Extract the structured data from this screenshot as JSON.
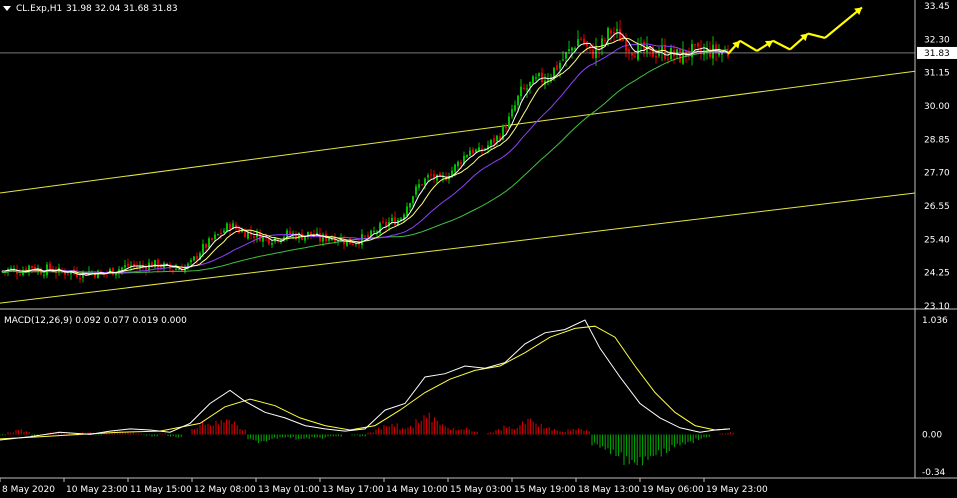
{
  "header": {
    "symbol_label": "CL.Exp,H1",
    "ohlc_text": "31.98 32.04 31.68 31.83"
  },
  "colors": {
    "background": "#000000",
    "bull_candle": "#00c000",
    "bear_candle": "#e00000",
    "ma_fast": "#ffffff",
    "ma_mid": "#ffff80",
    "ma_slow_purple": "#9040ff",
    "ma_slow_green": "#40c040",
    "channel": "#e6e640",
    "forecast_arrow": "#ffff00",
    "macd_line": "#ffffff",
    "signal_line": "#ffff40",
    "hist_positive": "#e00000",
    "hist_negative": "#00b000",
    "price_badge_bg": "#ffffff",
    "grid_line": "#c0c0c0"
  },
  "chart_data": [
    {
      "type": "candlestick",
      "title": "",
      "price_axis_ticks": [
        "33.45",
        "32.30",
        "31.15",
        "30.00",
        "28.85",
        "27.70",
        "26.55",
        "25.40",
        "24.25",
        "23.10"
      ],
      "ylim": [
        23.1,
        33.45
      ],
      "current_price": "31.83",
      "x_tick_labels": [
        "8 May 2020",
        "10 May 23:00",
        "11 May 15:00",
        "12 May 08:00",
        "13 May 01:00",
        "13 May 17:00",
        "14 May 10:00",
        "15 May 03:00",
        "15 May 19:00",
        "18 May 13:00",
        "19 May 06:00",
        "19 May 23:00"
      ],
      "close_path": [
        [
          0,
          24.3
        ],
        [
          10,
          24.35
        ],
        [
          20,
          24.3
        ],
        [
          30,
          24.5
        ],
        [
          40,
          24.3
        ],
        [
          50,
          24.4
        ],
        [
          60,
          24.25
        ],
        [
          70,
          24.3
        ],
        [
          80,
          24.2
        ],
        [
          90,
          24.3
        ],
        [
          100,
          24.2
        ],
        [
          110,
          24.3
        ],
        [
          120,
          24.4
        ],
        [
          130,
          24.5
        ],
        [
          140,
          24.45
        ],
        [
          150,
          24.55
        ],
        [
          160,
          24.5
        ],
        [
          170,
          24.4
        ],
        [
          180,
          24.4
        ],
        [
          190,
          24.5
        ],
        [
          200,
          25.0
        ],
        [
          210,
          25.3
        ],
        [
          220,
          25.6
        ],
        [
          230,
          25.9
        ],
        [
          240,
          25.7
        ],
        [
          250,
          25.6
        ],
        [
          260,
          25.5
        ],
        [
          270,
          25.4
        ],
        [
          280,
          25.5
        ],
        [
          290,
          25.6
        ],
        [
          300,
          25.5
        ],
        [
          310,
          25.6
        ],
        [
          320,
          25.4
        ],
        [
          330,
          25.5
        ],
        [
          340,
          25.4
        ],
        [
          350,
          25.3
        ],
        [
          360,
          25.4
        ],
        [
          370,
          25.5
        ],
        [
          380,
          25.8
        ],
        [
          390,
          26.0
        ],
        [
          400,
          26.1
        ],
        [
          410,
          26.8
        ],
        [
          420,
          27.3
        ],
        [
          430,
          27.6
        ],
        [
          440,
          27.4
        ],
        [
          450,
          27.7
        ],
        [
          460,
          28.1
        ],
        [
          470,
          28.5
        ],
        [
          480,
          28.4
        ],
        [
          490,
          28.7
        ],
        [
          500,
          29.0
        ],
        [
          510,
          29.6
        ],
        [
          520,
          30.4
        ],
        [
          530,
          30.7
        ],
        [
          540,
          30.9
        ],
        [
          550,
          31.1
        ],
        [
          560,
          31.5
        ],
        [
          570,
          31.9
        ],
        [
          580,
          32.4
        ],
        [
          590,
          31.8
        ],
        [
          600,
          32.0
        ],
        [
          610,
          32.6
        ],
        [
          620,
          32.4
        ],
        [
          630,
          32.0
        ],
        [
          640,
          31.9
        ],
        [
          650,
          31.8
        ],
        [
          660,
          31.9
        ],
        [
          670,
          31.8
        ],
        [
          680,
          31.7
        ],
        [
          690,
          31.9
        ],
        [
          700,
          31.8
        ],
        [
          710,
          31.9
        ],
        [
          720,
          31.85
        ],
        [
          730,
          31.83
        ]
      ],
      "channel_lines": [
        {
          "from": [
            0,
            27.0
          ],
          "to": [
            915,
            31.2
          ]
        },
        {
          "from": [
            0,
            23.2
          ],
          "to": [
            915,
            27.0
          ]
        }
      ],
      "forecast_path": [
        [
          728,
          31.8
        ],
        [
          740,
          32.25
        ],
        [
          757,
          31.9
        ],
        [
          773,
          32.25
        ],
        [
          790,
          31.95
        ],
        [
          808,
          32.5
        ],
        [
          825,
          32.35
        ],
        [
          862,
          33.4
        ]
      ]
    },
    {
      "type": "macd",
      "title": "MACD(12,26,9) 0.092 0.077 0.019 0.000",
      "axis_ticks": [
        "1.036",
        "0.00",
        "-0.34"
      ],
      "ylim": [
        -0.34,
        1.036
      ],
      "macd_path": [
        [
          0,
          -0.05
        ],
        [
          30,
          -0.02
        ],
        [
          60,
          0.02
        ],
        [
          90,
          0.0
        ],
        [
          110,
          0.03
        ],
        [
          130,
          0.05
        ],
        [
          150,
          0.04
        ],
        [
          170,
          0.02
        ],
        [
          190,
          0.1
        ],
        [
          210,
          0.28
        ],
        [
          230,
          0.4
        ],
        [
          245,
          0.3
        ],
        [
          265,
          0.2
        ],
        [
          285,
          0.15
        ],
        [
          305,
          0.08
        ],
        [
          325,
          0.05
        ],
        [
          345,
          0.03
        ],
        [
          365,
          0.05
        ],
        [
          385,
          0.22
        ],
        [
          405,
          0.28
        ],
        [
          425,
          0.52
        ],
        [
          445,
          0.55
        ],
        [
          465,
          0.62
        ],
        [
          485,
          0.6
        ],
        [
          505,
          0.65
        ],
        [
          525,
          0.82
        ],
        [
          545,
          0.92
        ],
        [
          565,
          0.95
        ],
        [
          585,
          1.036
        ],
        [
          600,
          0.78
        ],
        [
          620,
          0.52
        ],
        [
          640,
          0.28
        ],
        [
          660,
          0.15
        ],
        [
          680,
          0.06
        ],
        [
          700,
          0.02
        ],
        [
          715,
          0.04
        ],
        [
          730,
          0.05
        ]
      ],
      "signal_path": [
        [
          0,
          -0.04
        ],
        [
          40,
          -0.02
        ],
        [
          80,
          0.0
        ],
        [
          120,
          0.02
        ],
        [
          160,
          0.03
        ],
        [
          200,
          0.1
        ],
        [
          225,
          0.25
        ],
        [
          250,
          0.32
        ],
        [
          275,
          0.26
        ],
        [
          300,
          0.15
        ],
        [
          325,
          0.08
        ],
        [
          350,
          0.04
        ],
        [
          375,
          0.08
        ],
        [
          400,
          0.22
        ],
        [
          425,
          0.38
        ],
        [
          450,
          0.5
        ],
        [
          475,
          0.58
        ],
        [
          500,
          0.62
        ],
        [
          525,
          0.74
        ],
        [
          550,
          0.88
        ],
        [
          575,
          0.96
        ],
        [
          595,
          0.98
        ],
        [
          615,
          0.88
        ],
        [
          635,
          0.62
        ],
        [
          655,
          0.38
        ],
        [
          675,
          0.2
        ],
        [
          695,
          0.08
        ],
        [
          715,
          0.04
        ],
        [
          730,
          0.05
        ]
      ],
      "histogram": [
        [
          0,
          -0.01
        ],
        [
          8,
          0.02
        ],
        [
          16,
          0.05
        ],
        [
          24,
          0.03
        ],
        [
          32,
          -0.02
        ],
        [
          40,
          0.0
        ],
        [
          48,
          0.02
        ],
        [
          56,
          0.03
        ],
        [
          64,
          0.01
        ],
        [
          72,
          -0.01
        ],
        [
          80,
          0.02
        ],
        [
          88,
          0.02
        ],
        [
          96,
          -0.01
        ],
        [
          104,
          0.02
        ],
        [
          112,
          0.04
        ],
        [
          120,
          0.03
        ],
        [
          128,
          0.02
        ],
        [
          136,
          0.01
        ],
        [
          144,
          -0.01
        ],
        [
          152,
          -0.02
        ],
        [
          160,
          0.01
        ],
        [
          168,
          -0.02
        ],
        [
          176,
          -0.03
        ],
        [
          184,
          0.0
        ],
        [
          192,
          0.06
        ],
        [
          200,
          0.12
        ],
        [
          208,
          0.1
        ],
        [
          216,
          0.13
        ],
        [
          224,
          0.15
        ],
        [
          232,
          0.12
        ],
        [
          240,
          0.05
        ],
        [
          248,
          -0.05
        ],
        [
          256,
          -0.08
        ],
        [
          264,
          -0.07
        ],
        [
          272,
          -0.04
        ],
        [
          280,
          -0.03
        ],
        [
          288,
          -0.03
        ],
        [
          296,
          -0.05
        ],
        [
          304,
          -0.04
        ],
        [
          312,
          -0.03
        ],
        [
          320,
          -0.04
        ],
        [
          328,
          -0.02
        ],
        [
          336,
          -0.02
        ],
        [
          344,
          0.0
        ],
        [
          352,
          -0.01
        ],
        [
          360,
          -0.02
        ],
        [
          368,
          0.02
        ],
        [
          376,
          0.06
        ],
        [
          384,
          0.09
        ],
        [
          392,
          0.1
        ],
        [
          400,
          0.06
        ],
        [
          408,
          0.08
        ],
        [
          416,
          0.14
        ],
        [
          424,
          0.2
        ],
        [
          432,
          0.16
        ],
        [
          440,
          0.1
        ],
        [
          448,
          0.06
        ],
        [
          456,
          0.05
        ],
        [
          464,
          0.06
        ],
        [
          472,
          0.03
        ],
        [
          480,
          0.0
        ],
        [
          488,
          0.02
        ],
        [
          496,
          0.05
        ],
        [
          504,
          0.08
        ],
        [
          512,
          0.06
        ],
        [
          520,
          0.12
        ],
        [
          528,
          0.16
        ],
        [
          536,
          0.1
        ],
        [
          544,
          0.07
        ],
        [
          552,
          0.05
        ],
        [
          560,
          0.03
        ],
        [
          568,
          0.05
        ],
        [
          576,
          0.06
        ],
        [
          584,
          0.04
        ],
        [
          592,
          -0.1
        ],
        [
          600,
          -0.14
        ],
        [
          608,
          -0.18
        ],
        [
          616,
          -0.22
        ],
        [
          624,
          -0.28
        ],
        [
          632,
          -0.3
        ],
        [
          640,
          -0.28
        ],
        [
          648,
          -0.24
        ],
        [
          656,
          -0.2
        ],
        [
          664,
          -0.18
        ],
        [
          672,
          -0.12
        ],
        [
          680,
          -0.1
        ],
        [
          688,
          -0.08
        ],
        [
          696,
          -0.05
        ],
        [
          704,
          -0.03
        ],
        [
          712,
          0.0
        ],
        [
          720,
          0.01
        ],
        [
          728,
          0.02
        ]
      ]
    }
  ]
}
